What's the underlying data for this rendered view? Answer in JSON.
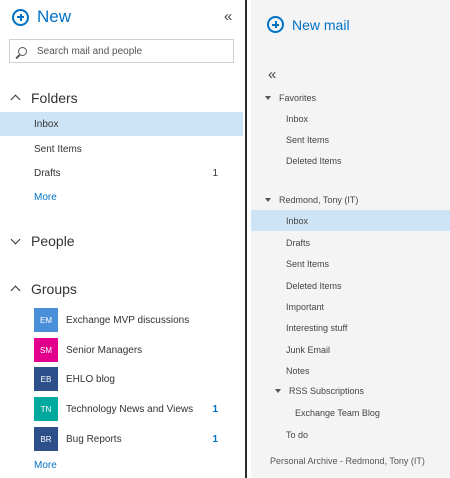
{
  "left": {
    "new_label": "New",
    "search_placeholder": "Search mail and people",
    "folders_header": "Folders",
    "folders": [
      {
        "label": "Inbox",
        "count": ""
      },
      {
        "label": "Sent Items",
        "count": ""
      },
      {
        "label": "Drafts",
        "count": "1"
      }
    ],
    "folders_more": "More",
    "people_header": "People",
    "groups_header": "Groups",
    "groups": [
      {
        "initials": "EM",
        "name": "Exchange MVP discussions",
        "count": "",
        "color": "#4a90d9"
      },
      {
        "initials": "SM",
        "name": "Senior Managers",
        "count": "",
        "color": "#e3008c"
      },
      {
        "initials": "EB",
        "name": "EHLO blog",
        "count": "",
        "color": "#2d4f8a"
      },
      {
        "initials": "TN",
        "name": "Technology News and Views",
        "count": "1",
        "color": "#00a99d"
      },
      {
        "initials": "BR",
        "name": "Bug Reports",
        "count": "1",
        "color": "#2d4f8a"
      }
    ],
    "groups_more": "More"
  },
  "right": {
    "new_mail_label": "New mail",
    "favorites_header": "Favorites",
    "favorites": [
      "Inbox",
      "Sent Items",
      "Deleted Items"
    ],
    "account_header": "Redmond, Tony (IT)",
    "account_folders": [
      "Inbox",
      "Drafts",
      "Sent Items",
      "Deleted Items",
      "Important",
      "Interesting stuff",
      "Junk Email",
      "Notes"
    ],
    "rss_header": "RSS Subscriptions",
    "rss_items": [
      "Exchange Team Blog"
    ],
    "todo_label": "To do",
    "footer": "Personal Archive - Redmond, Tony (IT)"
  },
  "colors": {
    "accent": "#0072c6",
    "selected": "#cce4f6"
  },
  "icons": {
    "new": "plus-circle-icon",
    "collapse": "double-chevron-left-icon",
    "search": "search-icon"
  }
}
